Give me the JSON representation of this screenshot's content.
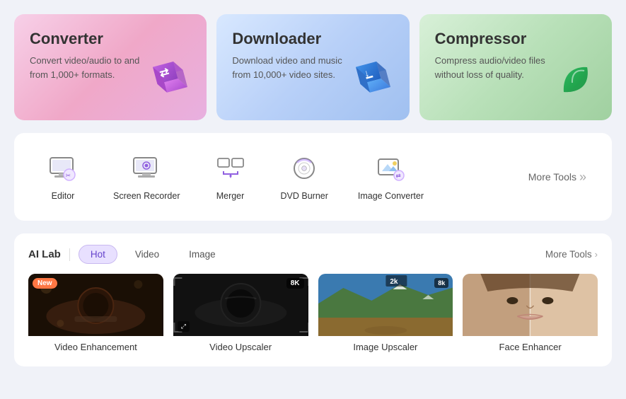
{
  "cards": [
    {
      "id": "converter",
      "title": "Converter",
      "desc": "Convert video/audio to and from 1,000+ formats.",
      "theme": "pink"
    },
    {
      "id": "downloader",
      "title": "Downloader",
      "desc": "Download video and music from 10,000+ video sites.",
      "theme": "blue"
    },
    {
      "id": "compressor",
      "title": "Compressor",
      "desc": "Compress audio/video files without loss of quality.",
      "theme": "green"
    }
  ],
  "tools": [
    {
      "id": "editor",
      "label": "Editor"
    },
    {
      "id": "screen-recorder",
      "label": "Screen Recorder"
    },
    {
      "id": "merger",
      "label": "Merger"
    },
    {
      "id": "dvd-burner",
      "label": "DVD Burner"
    },
    {
      "id": "image-converter",
      "label": "Image Converter"
    }
  ],
  "more_tools_label": "More Tools",
  "ai_lab": {
    "label": "AI Lab",
    "tabs": [
      {
        "id": "hot",
        "label": "Hot",
        "active": true
      },
      {
        "id": "video",
        "label": "Video",
        "active": false
      },
      {
        "id": "image",
        "label": "Image",
        "active": false
      }
    ],
    "more_tools_label": "More Tools",
    "items": [
      {
        "id": "video-enhancement",
        "label": "Video Enhancement",
        "badge": "New",
        "thumb": "enhancement"
      },
      {
        "id": "video-upscaler",
        "label": "Video Upscaler",
        "badge": "8K",
        "thumb": "upscaler"
      },
      {
        "id": "image-upscaler",
        "label": "Image Upscaler",
        "badge": "8k",
        "thumb": "image-upscaler"
      },
      {
        "id": "face-enhancer",
        "label": "Face Enhancer",
        "badge": null,
        "thumb": "face"
      }
    ]
  }
}
